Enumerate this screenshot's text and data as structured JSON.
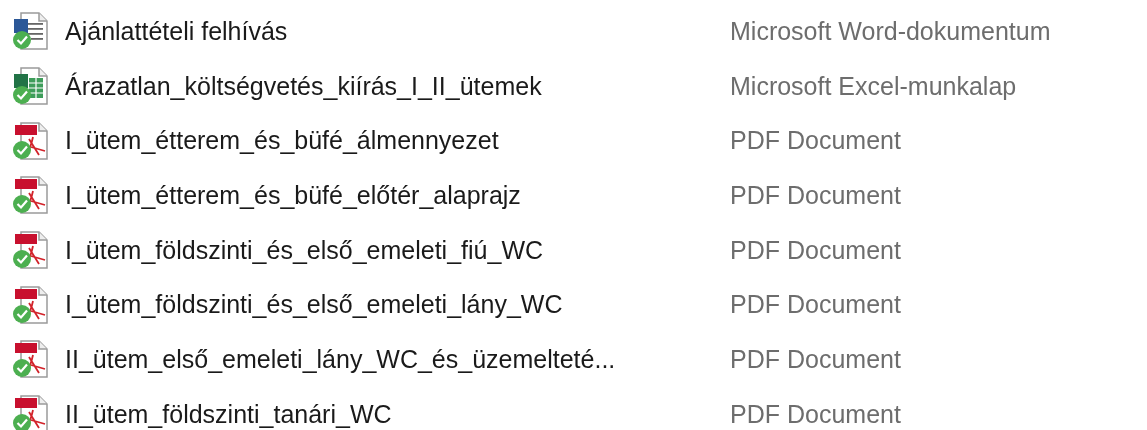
{
  "files": [
    {
      "name": "Ajánlattételi felhívás",
      "type": "Microsoft Word-dokumentum",
      "kind": "word"
    },
    {
      "name": "Árazatlan_költségvetés_kiírás_I_II_ütemek",
      "type": "Microsoft Excel-munkalap",
      "kind": "excel"
    },
    {
      "name": "I_ütem_étterem_és_büfé_álmennyezet",
      "type": "PDF Document",
      "kind": "pdf"
    },
    {
      "name": "I_ütem_étterem_és_büfé_előtér_alaprajz",
      "type": "PDF Document",
      "kind": "pdf"
    },
    {
      "name": "I_ütem_földszinti_és_első_emeleti_fiú_WC",
      "type": "PDF Document",
      "kind": "pdf"
    },
    {
      "name": "I_ütem_földszinti_és_első_emeleti_lány_WC",
      "type": "PDF Document",
      "kind": "pdf"
    },
    {
      "name": "II_ütem_első_emeleti_lány_WC_és_üzemelteté...",
      "type": "PDF Document",
      "kind": "pdf"
    },
    {
      "name": "II_ütem_földszinti_tanári_WC",
      "type": "PDF Document",
      "kind": "pdf"
    }
  ]
}
